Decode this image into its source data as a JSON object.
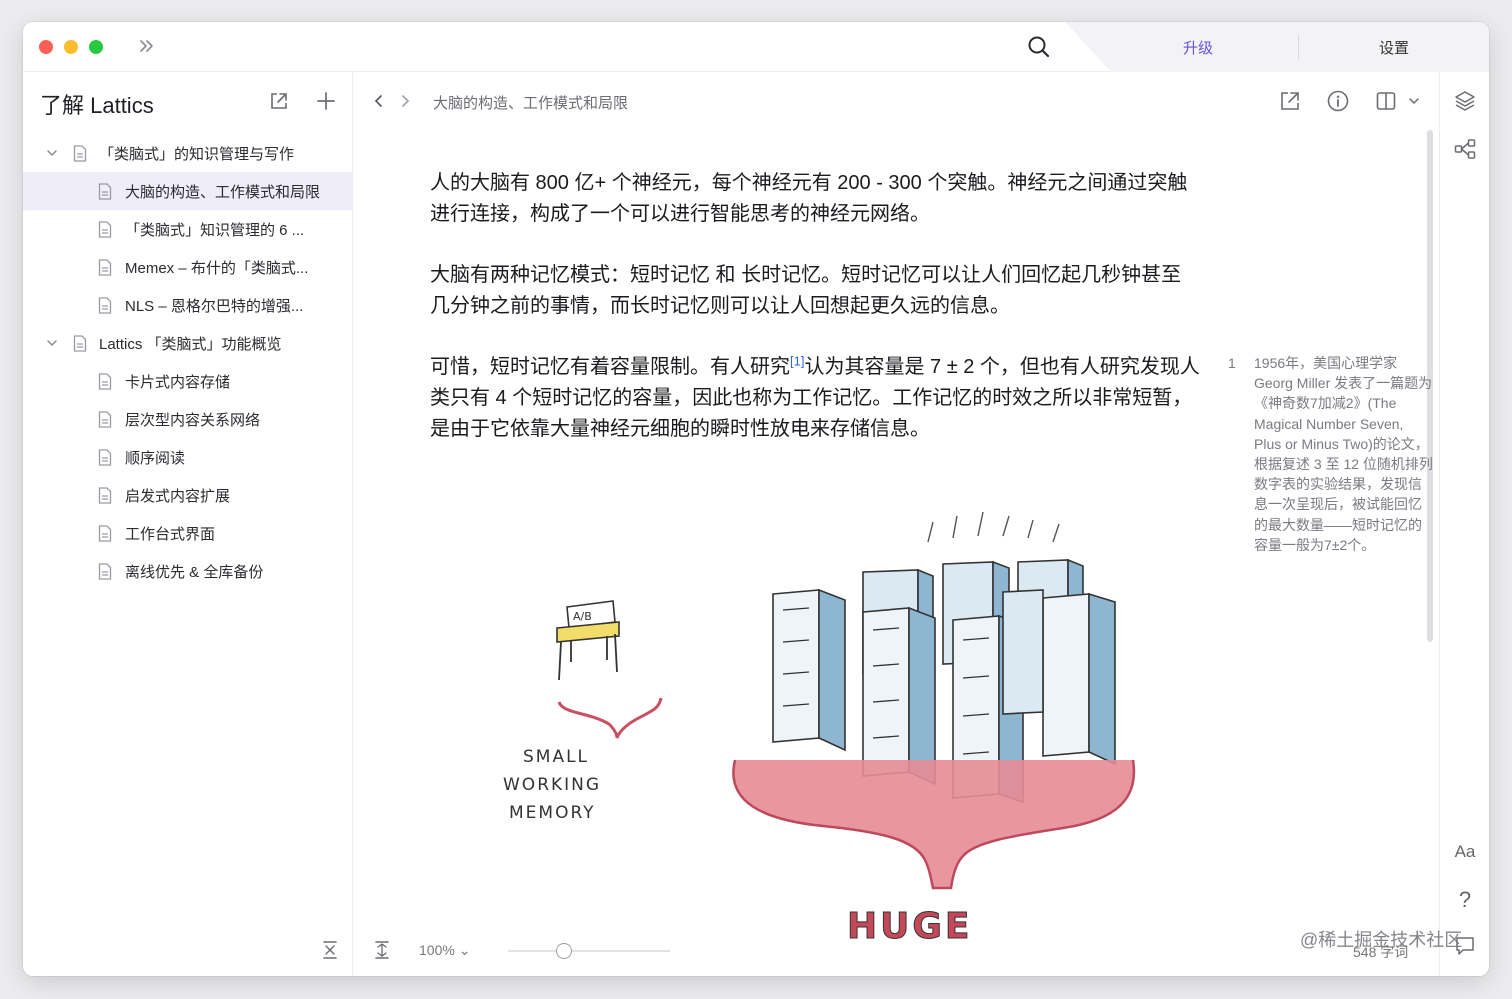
{
  "titlebar": {
    "upgrade_label": "升级",
    "settings_label": "设置",
    "colors": {
      "upgrade": "#6b4fe0",
      "close": "#fe5f57",
      "minimize": "#febc2e",
      "maximize": "#28c840"
    }
  },
  "sidebar": {
    "title": "了解 Lattics",
    "items": [
      {
        "label": "「类脑式」的知识管理与写作",
        "level": 0,
        "expanded": true,
        "active": false
      },
      {
        "label": "大脑的构造、工作模式和局限",
        "level": 1,
        "active": true
      },
      {
        "label": "「类脑式」知识管理的 6 ...",
        "level": 1,
        "active": false
      },
      {
        "label": "Memex – 布什的「类脑式...",
        "level": 1,
        "active": false
      },
      {
        "label": "NLS – 恩格尔巴特的增强...",
        "level": 1,
        "active": false
      },
      {
        "label": "Lattics 「类脑式」功能概览",
        "level": 0,
        "expanded": true,
        "active": false
      },
      {
        "label": "卡片式内容存储",
        "level": 1,
        "active": false
      },
      {
        "label": "层次型内容关系网络",
        "level": 1,
        "active": false
      },
      {
        "label": "顺序阅读",
        "level": 1,
        "active": false
      },
      {
        "label": "启发式内容扩展",
        "level": 1,
        "active": false
      },
      {
        "label": "工作台式界面",
        "level": 1,
        "active": false
      },
      {
        "label": "离线优先 & 全库备份",
        "level": 1,
        "active": false
      }
    ]
  },
  "toolbar": {
    "breadcrumb": "大脑的构造、工作模式和局限"
  },
  "document": {
    "p1": "人的大脑有 800 亿+ 个神经元，每个神经元有 200 - 300 个突触。神经元之间通过突触进行连接，构成了一个可以进行智能思考的神经元网络。",
    "p2": "大脑有两种记忆模式：短时记忆 和 长时记忆。短时记忆可以让人们回忆起几秒钟甚至几分钟之前的事情，而长时记忆则可以让人回想起更久远的信息。",
    "p3_before": "可惜，短时记忆有着容量限制。有人研究",
    "p3_ref": "[1]",
    "p3_after": "认为其容量是 7 ± 2 个，但也有人研究发现人类只有 4 个短时记忆的容量，因此也称为工作记忆。工作记忆的时效之所以非常短暂，是由于它依靠大量神经元细胞的瞬时性放电来存储信息。",
    "illustration": {
      "small_label_1": "SMALL",
      "small_label_2": "WORKING",
      "small_label_3": "MEMORY",
      "desk_note": "A/B",
      "huge_label": "HUGE"
    }
  },
  "footnote": {
    "number": "1",
    "text": "1956年，美国心理学家 Georg Miller 发表了一篇题为《神奇数7加减2》(The Magical Number Seven, Plus or Minus Two)的论文，根据复述 3 至 12 位随机排列数字表的实验结果，发现信息一次呈现后，被试能回忆的最大数量——短时记忆的容量一般为7±2个。"
  },
  "rail": {
    "font_label": "Aa",
    "help_label": "?"
  },
  "statusbar": {
    "zoom": "100% ⌄",
    "word_count": "548 字词",
    "watermark": "@稀土掘金技术社区"
  },
  "icons": [
    "expand-icon",
    "search-icon",
    "open-external-icon",
    "plus-icon",
    "chevron-down-icon",
    "document-icon",
    "chevron-left-icon",
    "chevron-right-icon",
    "info-icon",
    "split-view-icon",
    "layers-icon",
    "graph-icon",
    "collapse-icon",
    "wrap-icon",
    "comment-icon"
  ]
}
